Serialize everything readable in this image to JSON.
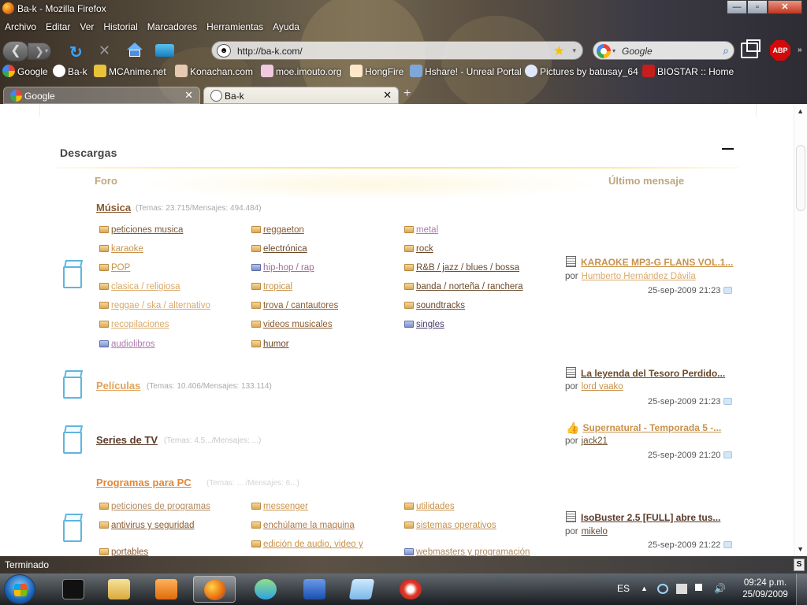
{
  "window": {
    "title": "Ba-k - Mozilla Firefox",
    "min": "—",
    "max": "▫",
    "close": "✕"
  },
  "menu": [
    "Archivo",
    "Editar",
    "Ver",
    "Historial",
    "Marcadores",
    "Herramientas",
    "Ayuda"
  ],
  "nav": {
    "url": "http://ba-k.com/",
    "search_placeholder": "Google",
    "abp": "ABP"
  },
  "bookmarks": [
    "Google",
    "Ba-k",
    "MCAnime.net",
    "Konachan.com",
    "moe.imouto.org",
    "HongFire",
    "Hshare! - Unreal Portal",
    "Pictures by batusay_64",
    "BIOSTAR :: Home"
  ],
  "tabs": [
    {
      "label": "Google",
      "active": false
    },
    {
      "label": "Ba-k",
      "active": true
    }
  ],
  "page": {
    "section_title": "Descargas",
    "col_forum": "Foro",
    "col_last": "Último mensaje",
    "forums": [
      {
        "title": "Música",
        "stats": "(Temas: 23.715/Mensajes: 494.484)",
        "subforums": [
          [
            "peticiones musica",
            "reggaeton",
            "metal"
          ],
          [
            "karaoke",
            "electrónica",
            "rock"
          ],
          [
            "POP",
            "hip-hop / rap",
            "R&B / jazz / blues / bossa"
          ],
          [
            "clasica / religiosa",
            "tropical",
            "banda / norteña / ranchera"
          ],
          [
            "reggae / ska / alternativo",
            "trova / cantautores",
            "soundtracks"
          ],
          [
            "recopilaciones",
            "videos musicales",
            "singles"
          ],
          [
            "audiolibros",
            "humor",
            ""
          ]
        ],
        "last": {
          "title": "KARAOKE MP3-G FLANS VOL.1...",
          "by_label": "por",
          "author": "Humberto Hernández Dávila",
          "date": "25-sep-2009 21:23"
        }
      },
      {
        "title": "Películas",
        "stats": "(Temas: 10.406/Mensajes: 133.114)",
        "subforums": [],
        "last": {
          "title": "La leyenda del Tesoro Perdido...",
          "by_label": "por",
          "author": "lord vaako",
          "date": "25-sep-2009 21:23"
        }
      },
      {
        "title": "Series de TV",
        "stats": "(Temas: 4.5.../Mensajes: ...)",
        "subforums": [],
        "last": {
          "title": "Supernatural - Temporada 5 -...",
          "by_label": "por",
          "author": "jack21",
          "date": "25-sep-2009 21:20"
        }
      },
      {
        "title": "Programas para PC",
        "stats": "(Temas: ... /Mensajes: 6...)",
        "subforums": [
          [
            "peticiones de programas",
            "messenger",
            "utilidades"
          ],
          [
            "antivirus y seguridad",
            "enchúlame la maquina",
            "sistemas operativos"
          ],
          [
            "portables",
            "edición de audio, video y",
            "webmasters y programación"
          ]
        ],
        "last": {
          "title": "IsoBuster 2.5 [FULL] abre tus...",
          "by_label": "por",
          "author": "mikelo",
          "date": "25-sep-2009 21:22"
        }
      }
    ]
  },
  "status": {
    "text": "Terminado"
  },
  "taskbar": {
    "lang": "ES",
    "time": "09:24 p.m.",
    "date": "25/09/2009"
  },
  "colors": {
    "link_gold": "#c8924a",
    "link_dark": "#6b4a2a",
    "forum_orange": "#e0883a",
    "icon_blue": "#5fb5e0",
    "divider_yellow": "#f3e58a"
  }
}
